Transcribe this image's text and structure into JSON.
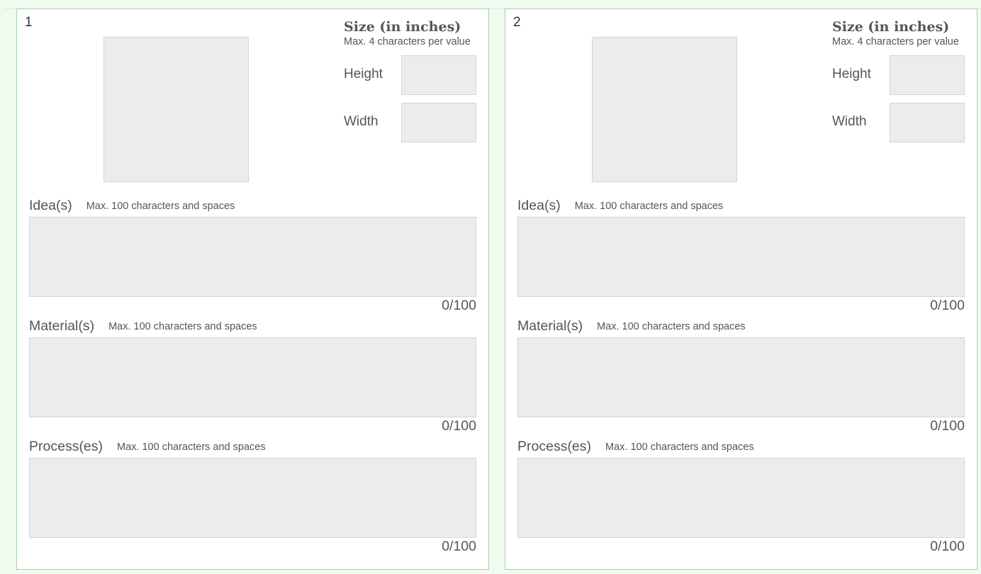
{
  "panels": [
    {
      "number": "1",
      "size": {
        "title": "Size (in inches)",
        "hint": "Max. 4 characters per value",
        "height_label": "Height",
        "height_value": "",
        "width_label": "Width",
        "width_value": ""
      },
      "fields": {
        "ideas": {
          "label": "Idea(s)",
          "hint": "Max. 100 characters and spaces",
          "value": "",
          "counter": "0/100"
        },
        "materials": {
          "label": "Material(s)",
          "hint": "Max. 100 characters and spaces",
          "value": "",
          "counter": "0/100"
        },
        "processes": {
          "label": "Process(es)",
          "hint": "Max. 100 characters and spaces",
          "value": "",
          "counter": "0/100"
        }
      }
    },
    {
      "number": "2",
      "size": {
        "title": "Size (in inches)",
        "hint": "Max. 4 characters per value",
        "height_label": "Height",
        "height_value": "",
        "width_label": "Width",
        "width_value": ""
      },
      "fields": {
        "ideas": {
          "label": "Idea(s)",
          "hint": "Max. 100 characters and spaces",
          "value": "",
          "counter": "0/100"
        },
        "materials": {
          "label": "Material(s)",
          "hint": "Max. 100 characters and spaces",
          "value": "",
          "counter": "0/100"
        },
        "processes": {
          "label": "Process(es)",
          "hint": "Max. 100 characters and spaces",
          "value": "",
          "counter": "0/100"
        }
      }
    }
  ],
  "colors": {
    "page_background": "#f0fbef",
    "panel_border": "#a7cfa6",
    "field_background": "#ececec"
  }
}
